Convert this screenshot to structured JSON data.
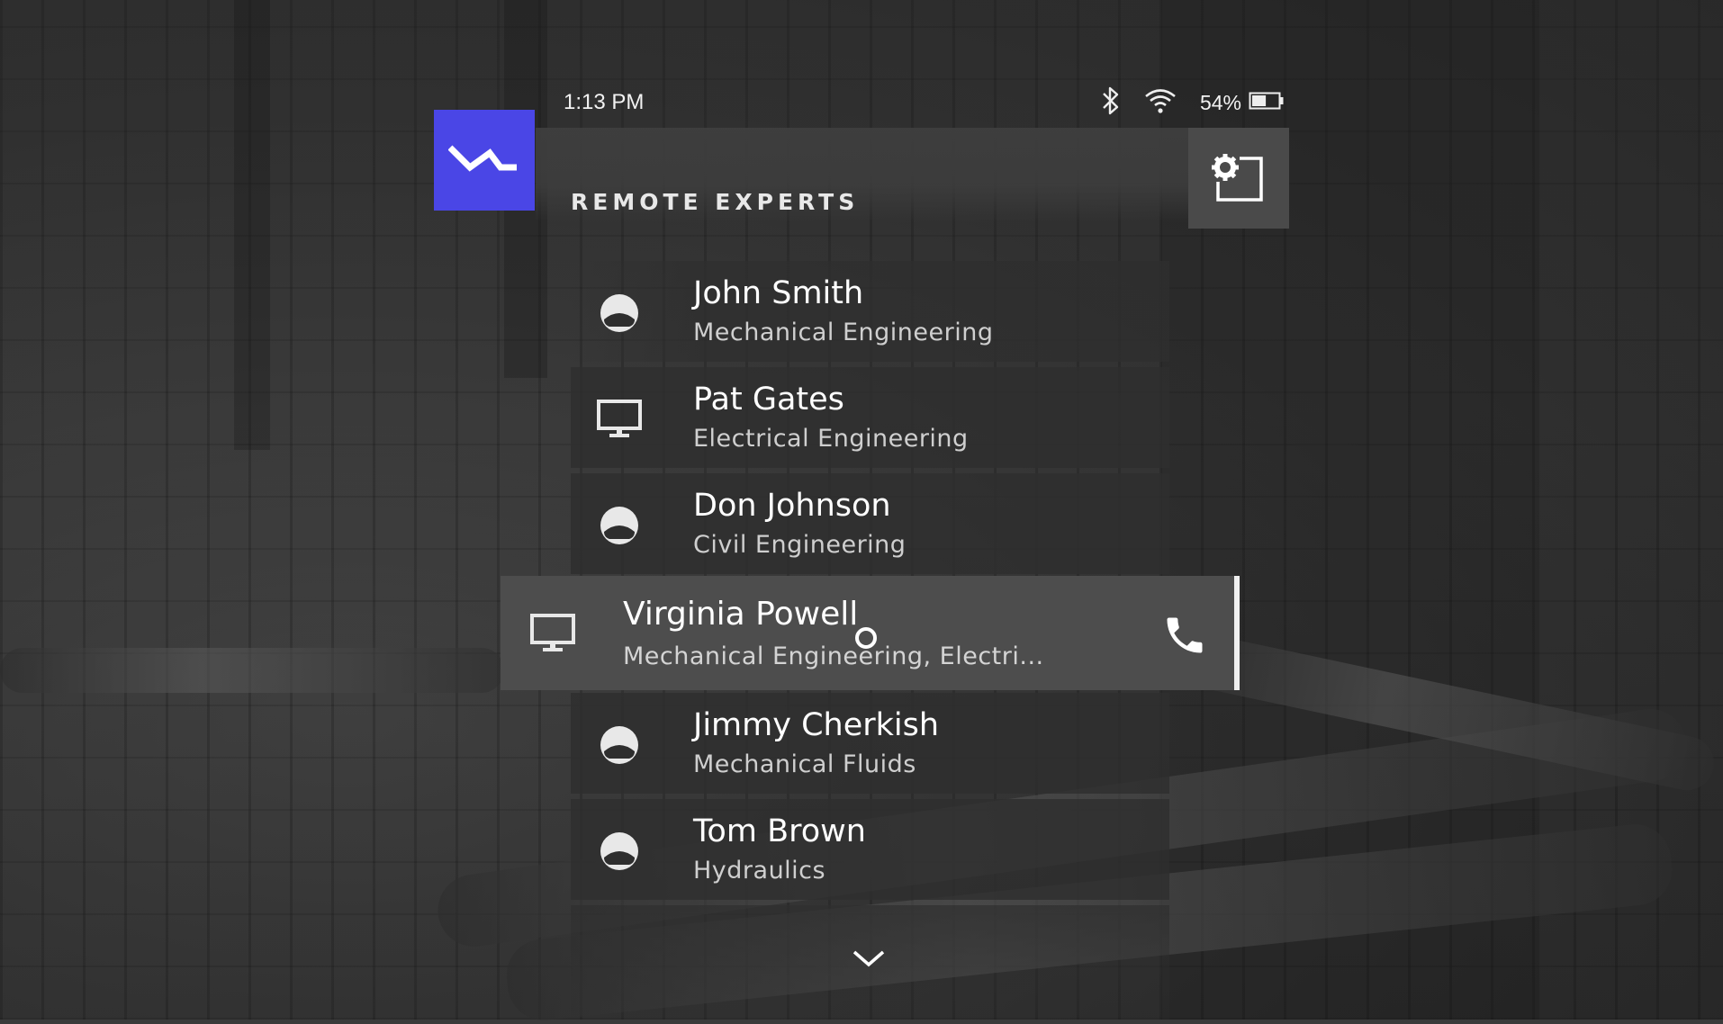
{
  "status": {
    "time": "1:13 PM",
    "battery_percent": "54%",
    "battery_level": 0.54,
    "icons": [
      "bluetooth-icon",
      "wifi-icon",
      "battery-icon"
    ]
  },
  "header": {
    "title": "REMOTE EXPERTS",
    "logo_icon": "app-logo-icon",
    "settings_icon": "settings-icon",
    "accent_color": "#4a46e6"
  },
  "experts": [
    {
      "name": "John Smith",
      "dept": "Mechanical Engineering",
      "device": "headset"
    },
    {
      "name": "Pat Gates",
      "dept": "Electrical Engineering",
      "device": "desktop"
    },
    {
      "name": "Don Johnson",
      "dept": "Civil Engineering",
      "device": "headset"
    },
    {
      "name": "Virginia Powell",
      "dept": "Mechanical Engineering, Electri...",
      "device": "desktop",
      "selected": true
    },
    {
      "name": "Jimmy Cherkish",
      "dept": "Mechanical Fluids",
      "device": "headset"
    },
    {
      "name": "Tom Brown",
      "dept": "Hydraulics",
      "device": "headset"
    }
  ],
  "actions": {
    "call_icon": "phone-icon",
    "more_icon": "chevron-down-icon"
  }
}
